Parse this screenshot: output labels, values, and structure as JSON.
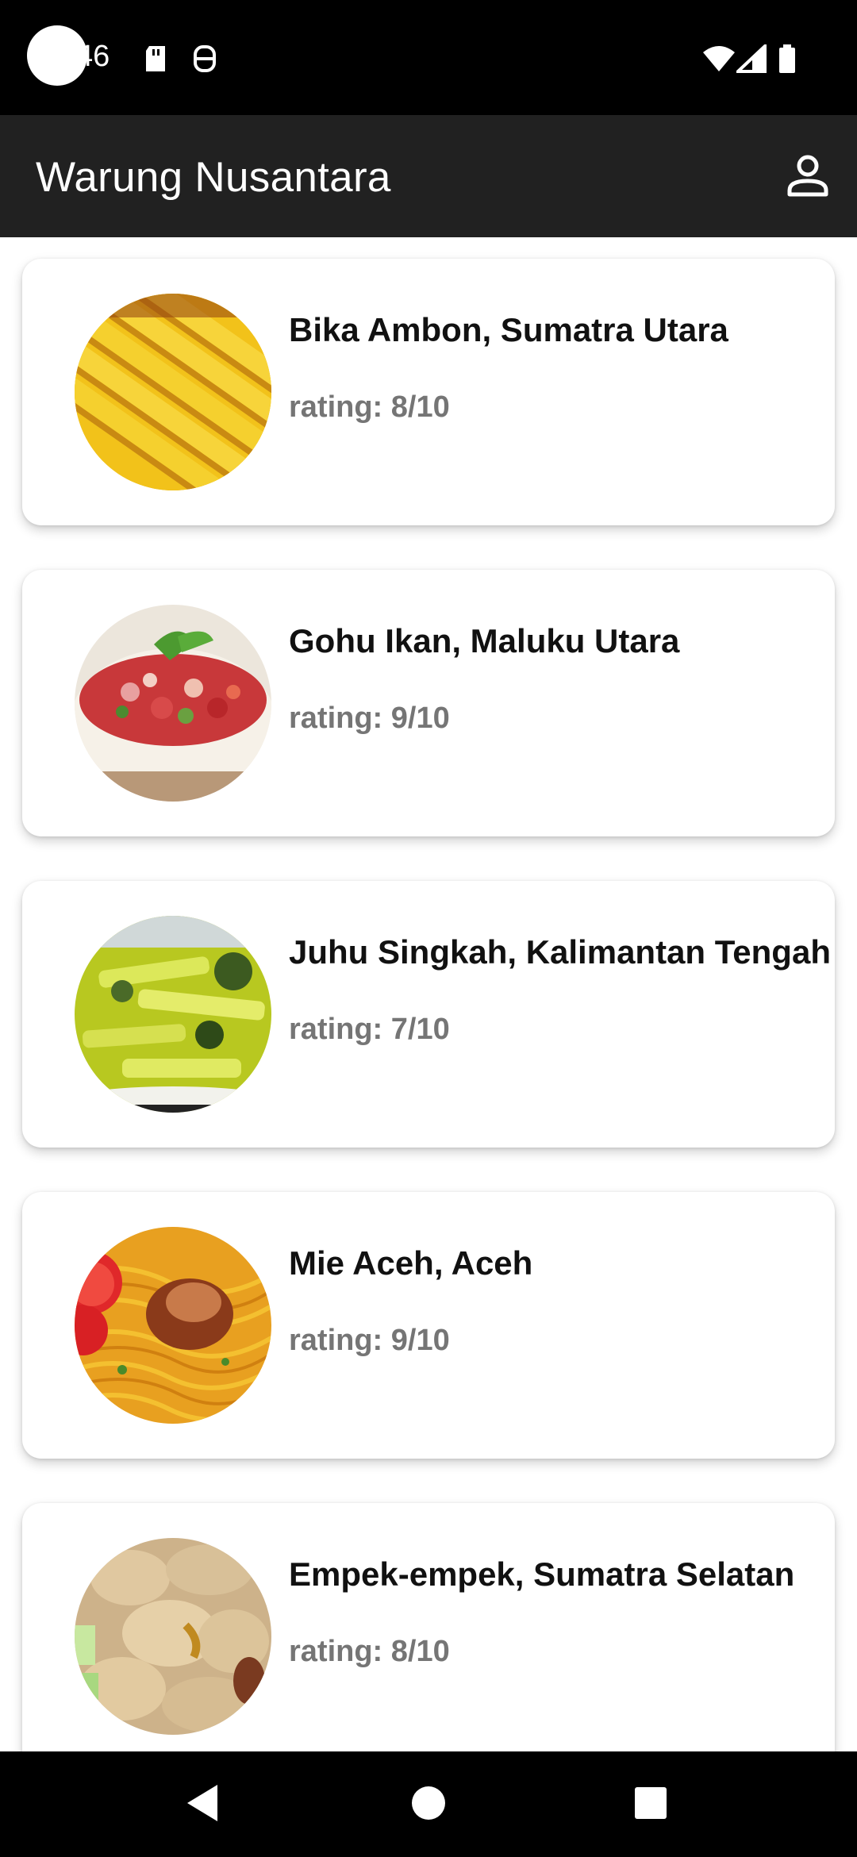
{
  "status": {
    "time": "46",
    "icons": [
      "sd-card-icon",
      "accessibility-icon",
      "wifi-icon",
      "signal-icon",
      "battery-icon"
    ]
  },
  "app_bar": {
    "title": "Warung Nusantara",
    "profile_icon": "person-icon"
  },
  "foods": [
    {
      "name": "Bika Ambon, Sumatra Utara",
      "rating": "rating: 8/10",
      "image": "bika-ambon-image"
    },
    {
      "name": "Gohu Ikan, Maluku Utara",
      "rating": "rating: 9/10",
      "image": "gohu-ikan-image"
    },
    {
      "name": "Juhu Singkah, Kalimantan Tengah",
      "rating": "rating: 7/10",
      "image": "juhu-singkah-image"
    },
    {
      "name": "Mie Aceh, Aceh",
      "rating": "rating: 9/10",
      "image": "mie-aceh-image"
    },
    {
      "name": "Empek-empek, Sumatra Selatan",
      "rating": "rating: 8/10",
      "image": "empek-empek-image"
    }
  ],
  "nav": {
    "back_icon": "back-triangle-icon",
    "home_icon": "home-circle-icon",
    "recents_icon": "recents-square-icon"
  },
  "colors": {
    "app_bar": "#212121",
    "rating_text": "#757575",
    "name_text": "#111111"
  }
}
